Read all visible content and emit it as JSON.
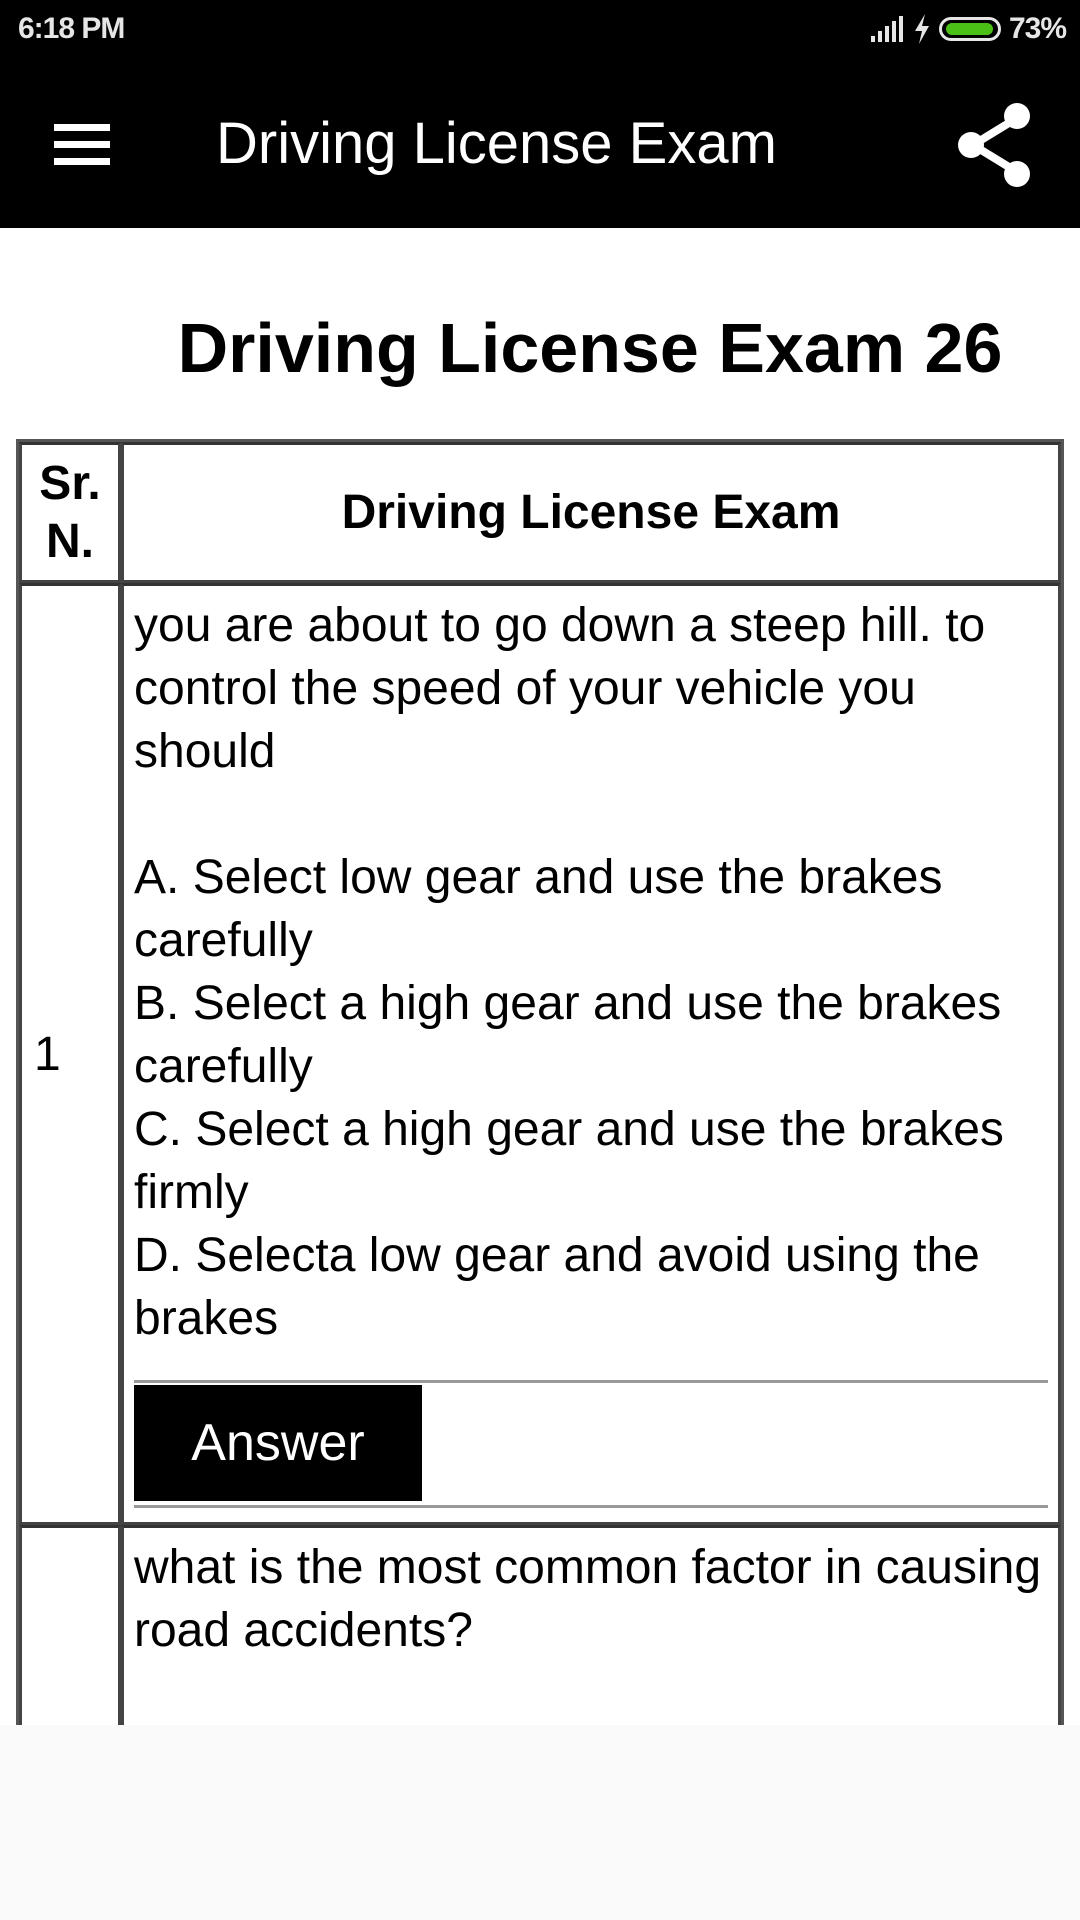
{
  "status_bar": {
    "time": "6:18 PM",
    "battery_percent": "73%",
    "battery_level": 0.73,
    "icons": [
      "signal-icon",
      "charging-icon",
      "battery-icon"
    ]
  },
  "app_bar": {
    "title": "Driving License Exam",
    "menu_icon": "hamburger-menu-icon",
    "share_icon": "share-icon"
  },
  "page": {
    "title": "Driving License Exam 26"
  },
  "table": {
    "headers": {
      "sr_line1": "Sr.",
      "sr_line2": "N.",
      "question": "Driving License Exam"
    },
    "rows": [
      {
        "sr": "1",
        "question": "you are about to go down a steep hill. to control the speed of your vehicle you should",
        "options": [
          "A. Select low gear and use the brakes carefully",
          "B. Select a high gear and use the brakes carefully",
          "C. Select a high gear and use the brakes firmly",
          "D. Selecta low gear and avoid using the brakes"
        ],
        "answer_label": "Answer"
      },
      {
        "sr": "",
        "question": "what is the most common factor in causing road accidents?"
      }
    ]
  }
}
